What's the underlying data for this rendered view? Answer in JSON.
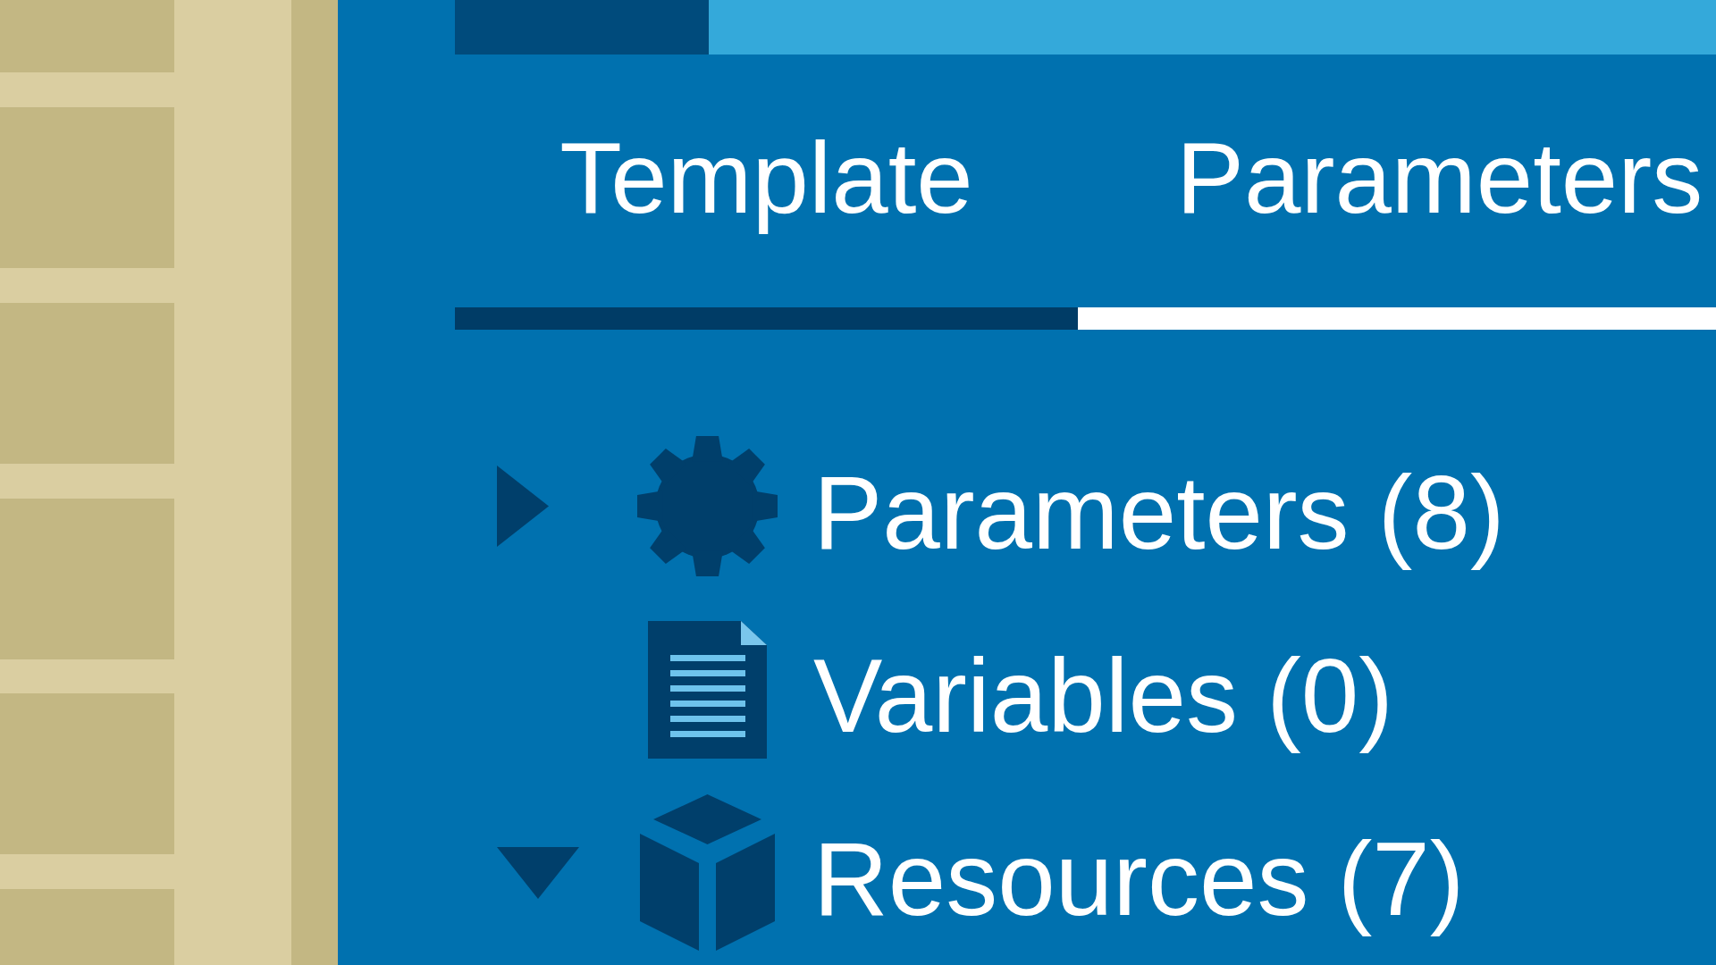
{
  "tabs": [
    {
      "label": "Template",
      "selected": false
    },
    {
      "label": "Parameters",
      "selected": true
    }
  ],
  "tree": [
    {
      "label": "Parameters (8)",
      "kind": "parameter",
      "expanded": false
    },
    {
      "label": "Variables (0)",
      "kind": "variable"
    },
    {
      "label": "Resources (7)",
      "kind": "resource",
      "expanded": true
    }
  ]
}
